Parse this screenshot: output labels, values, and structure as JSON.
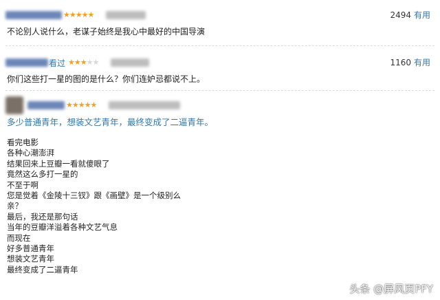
{
  "reviews": [
    {
      "rating": 5,
      "votes": "2494",
      "useful_label": "有用",
      "comment": "不论别人说什么，老谋子始终是我心中最好的中国导演"
    },
    {
      "author_suffix": "看过",
      "rating": 3,
      "votes": "1160",
      "useful_label": "有用",
      "comment": "你们这些打一星的图的是什么？你们连妒忌都说不上。"
    },
    {
      "rating": 5,
      "headline": "多少普通青年，想装文艺青年，最终变成了二逼青年。",
      "lines": [
        "看完电影",
        "各种心潮澎湃",
        "结果回来上豆瓣一看就傻眼了",
        "竟然这么多打一星的",
        "不至于啊",
        "您是觉着《金陵十三钗》跟《画壁》是一个级别么",
        "亲？",
        "最后，我还是那句话",
        "当年的豆瓣洋溢着各种文艺气息",
        "而现在",
        "好多普通青年",
        "想装文艺青年",
        "最终变成了二逼青年"
      ]
    }
  ],
  "colors": {
    "star": "#f7a01e",
    "link": "#3377aa"
  },
  "watermark": "头条 @屏风页PFY"
}
